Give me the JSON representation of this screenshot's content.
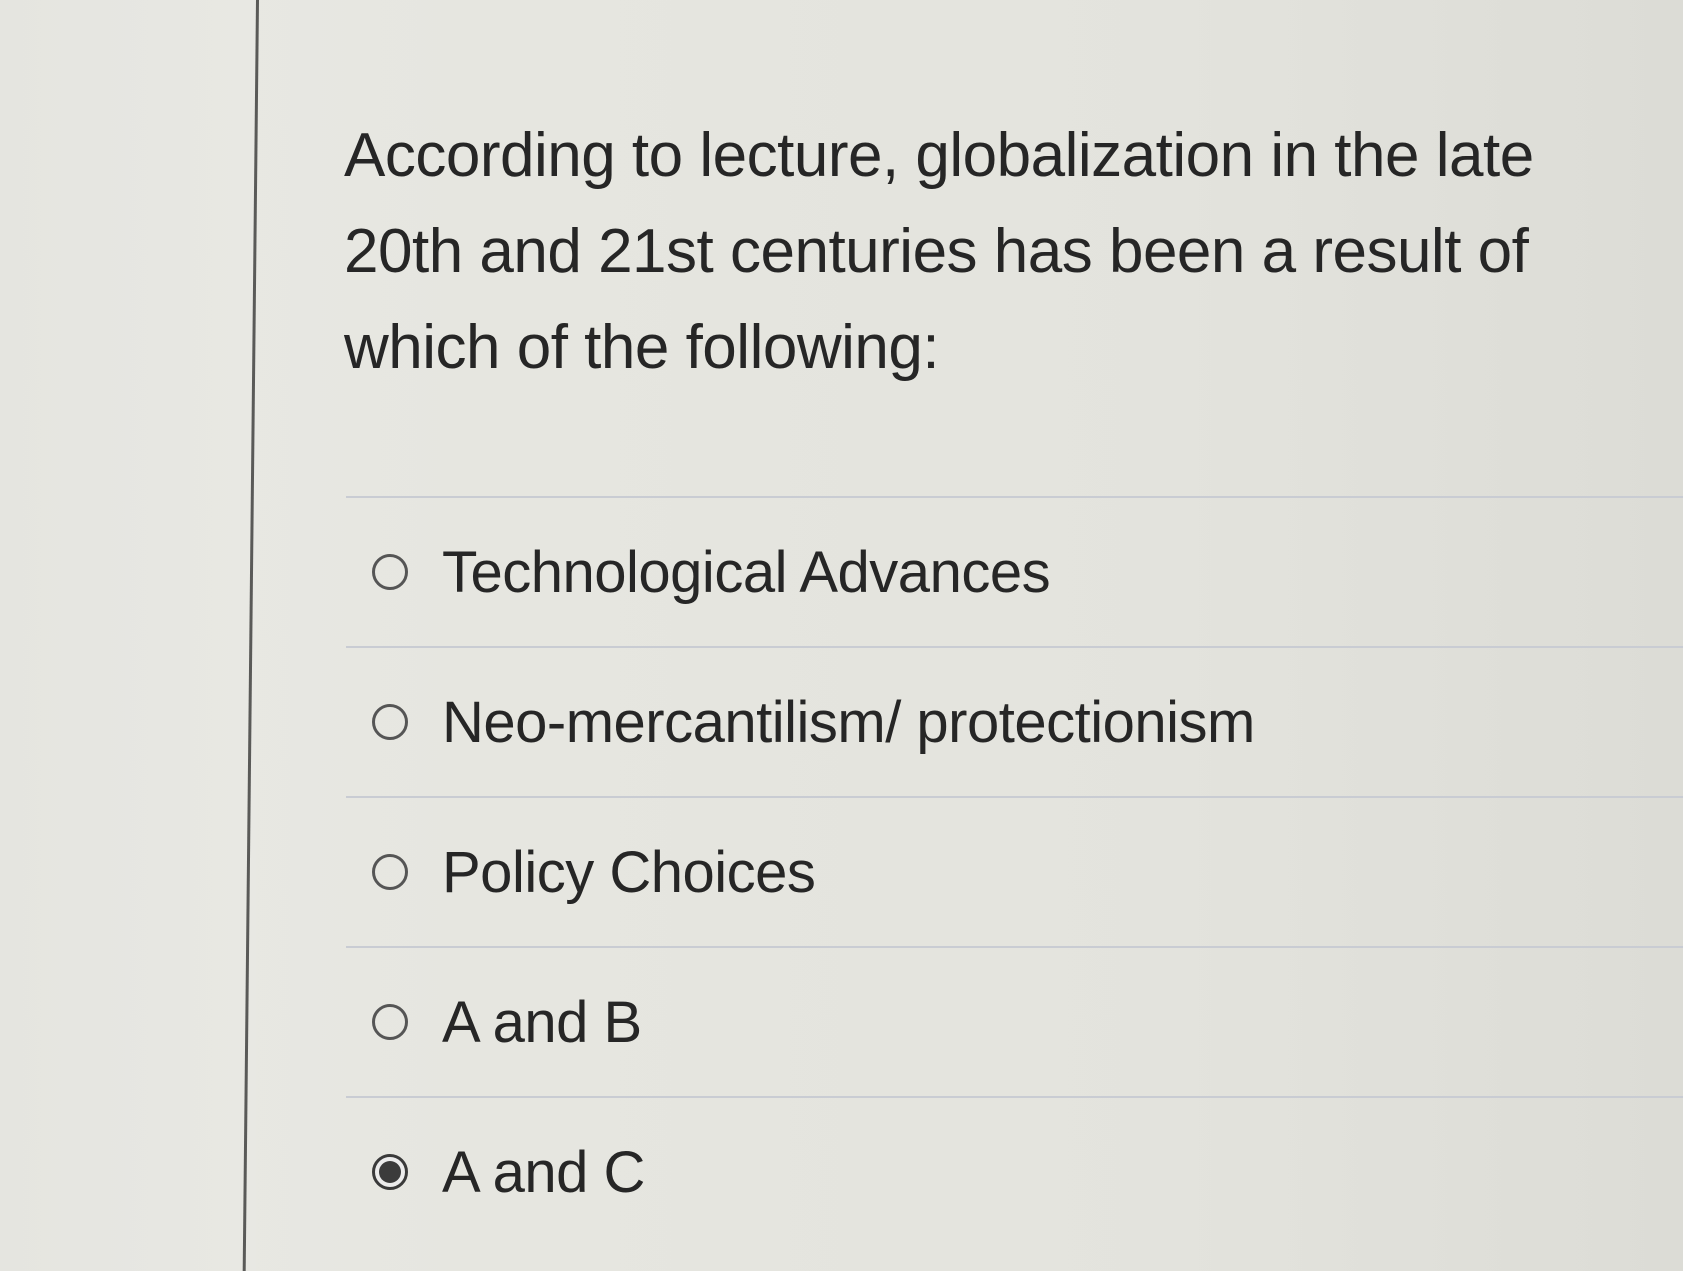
{
  "question": {
    "text": "According to lecture, globalization in the late 20th and 21st centuries has been a result of which of the following:"
  },
  "options": [
    {
      "label": "Technological Advances",
      "selected": false
    },
    {
      "label": "Neo-mercantilism/ protectionism",
      "selected": false
    },
    {
      "label": "Policy Choices",
      "selected": false
    },
    {
      "label": "A and B",
      "selected": false
    },
    {
      "label": "A and C",
      "selected": true
    }
  ]
}
